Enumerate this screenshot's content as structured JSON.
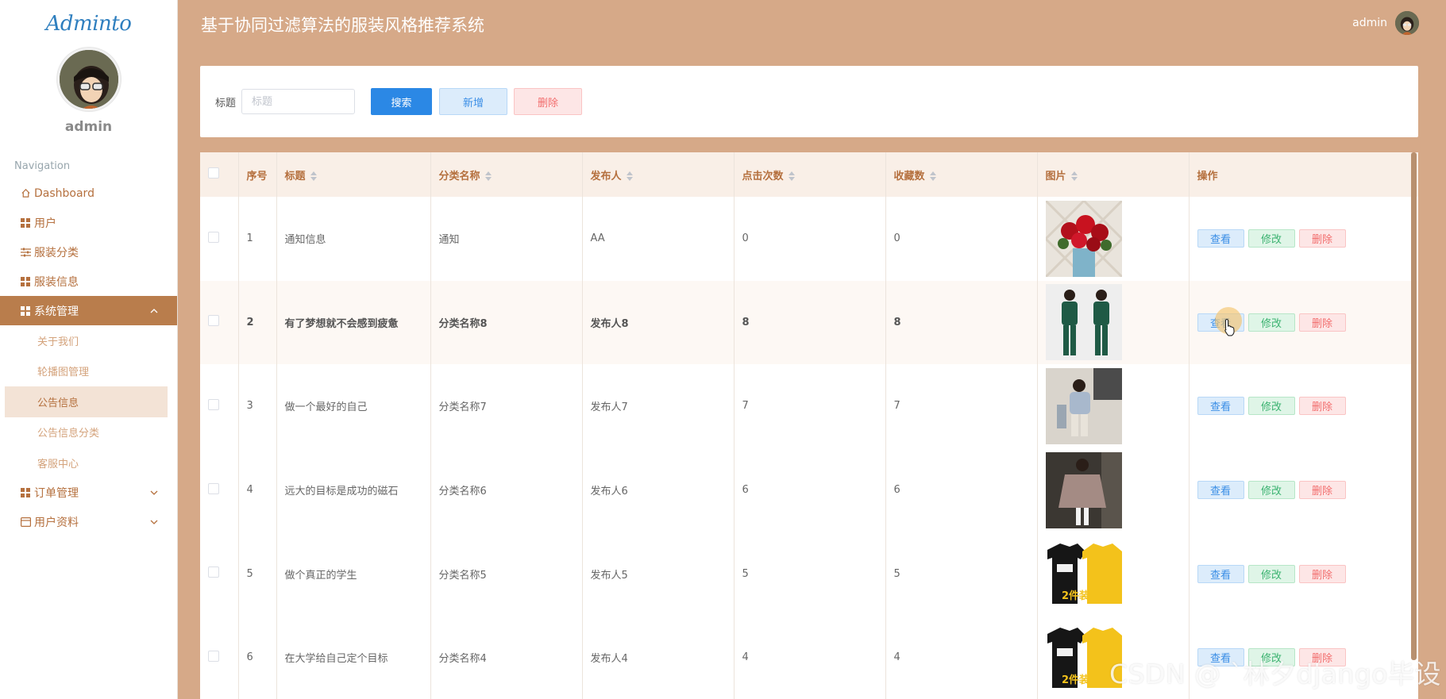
{
  "app": {
    "logo": "Adminto",
    "user": "admin",
    "title": "基于协同过滤算法的服装风格推荐系统"
  },
  "sidebar": {
    "nav_label": "Navigation",
    "items": [
      {
        "label": "Dashboard",
        "icon": "home-icon"
      },
      {
        "label": "用户",
        "icon": "grid-icon"
      },
      {
        "label": "服装分类",
        "icon": "sliders-icon"
      },
      {
        "label": "服装信息",
        "icon": "grid-icon"
      },
      {
        "label": "系统管理",
        "icon": "grid-icon",
        "active": true,
        "expanded": true
      },
      {
        "label": "订单管理",
        "icon": "grid-icon"
      },
      {
        "label": "用户资料",
        "icon": "card-icon"
      }
    ],
    "sub_items": [
      {
        "label": "关于我们"
      },
      {
        "label": "轮播图管理"
      },
      {
        "label": "公告信息",
        "active": true
      },
      {
        "label": "公告信息分类"
      },
      {
        "label": "客服中心"
      }
    ]
  },
  "search": {
    "label": "标题",
    "placeholder": "标题",
    "value": "",
    "search_button": "搜索",
    "add_button": "新增",
    "delete_button": "删除"
  },
  "table": {
    "columns": [
      "序号",
      "标题",
      "分类名称",
      "发布人",
      "点击次数",
      "收藏数",
      "图片",
      "操作"
    ],
    "op_labels": {
      "view": "查看",
      "edit": "修改",
      "delete": "删除"
    },
    "rows": [
      {
        "no": "1",
        "title": "通知信息",
        "category": "通知",
        "publisher": "AA",
        "clicks": "0",
        "favorites": "0",
        "image": "red-roses-bouquet"
      },
      {
        "no": "2",
        "title": "有了梦想就不会感到疲惫",
        "category": "分类名称8",
        "publisher": "发布人8",
        "clicks": "8",
        "favorites": "8",
        "image": "green-tracksuit-outfit"
      },
      {
        "no": "3",
        "title": "做一个最好的自己",
        "category": "分类名称7",
        "publisher": "发布人7",
        "clicks": "7",
        "favorites": "7",
        "image": "child-casual-outfit"
      },
      {
        "no": "4",
        "title": "远大的目标是成功的磁石",
        "category": "分类名称6",
        "publisher": "发布人6",
        "clicks": "6",
        "favorites": "6",
        "image": "poncho-sweater-outfit"
      },
      {
        "no": "5",
        "title": "做个真正的学生",
        "category": "分类名称5",
        "publisher": "发布人5",
        "clicks": "5",
        "favorites": "5",
        "image": "black-yellow-tshirts"
      },
      {
        "no": "6",
        "title": "在大学给自己定个目标",
        "category": "分类名称4",
        "publisher": "发布人4",
        "clicks": "4",
        "favorites": "4",
        "image": "black-yellow-tshirts"
      }
    ]
  },
  "watermark": "CSDN @ `林夕django毕设",
  "colors": {
    "header_bg": "#d6a988",
    "active_nav": "#b97d4c",
    "accent_text": "#b5703e",
    "primary_button": "#2b88e5"
  }
}
